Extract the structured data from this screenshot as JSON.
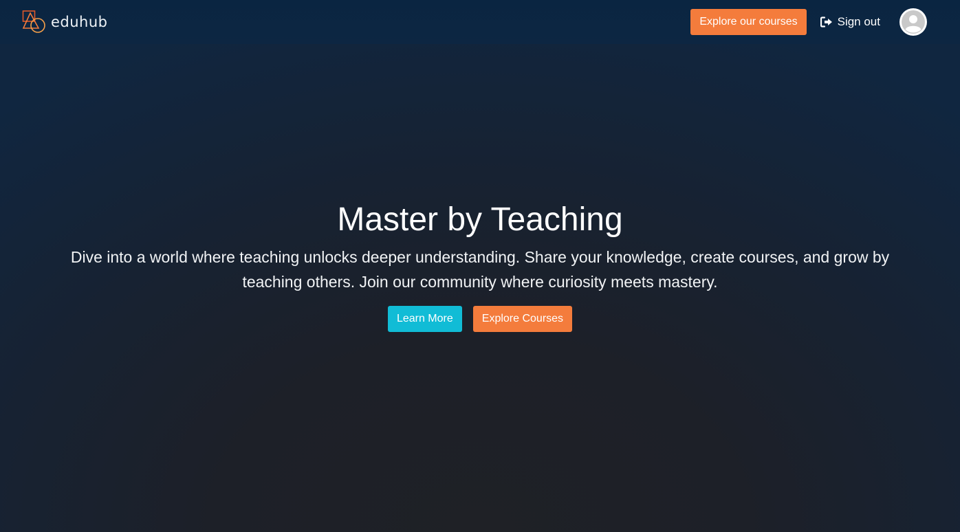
{
  "brand": {
    "name": "eduhub",
    "accent_color": "#f47c3c"
  },
  "nav": {
    "explore_label": "Explore our courses",
    "signout_label": "Sign out",
    "signout_icon": "sign-out-icon",
    "avatar_icon": "user-avatar-icon"
  },
  "hero": {
    "title": "Master by Teaching",
    "description": "Dive into a world where teaching unlocks deeper understanding. Share your knowledge, create courses, and grow by teaching others. Join our community where curiosity meets mastery.",
    "learn_more_label": "Learn More",
    "explore_label": "Explore Courses"
  },
  "colors": {
    "primary_orange": "#f47c3c",
    "cyan": "#11bcd6",
    "navbar": "#0a2541"
  }
}
